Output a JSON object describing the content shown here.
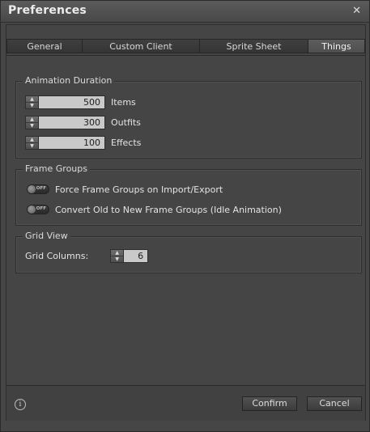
{
  "window": {
    "title": "Preferences",
    "close_icon": "close-icon"
  },
  "tabs": [
    {
      "label": "General"
    },
    {
      "label": "Custom Client"
    },
    {
      "label": "Sprite Sheet"
    },
    {
      "label": "Things",
      "active": true
    }
  ],
  "animation_duration": {
    "title": "Animation Duration",
    "rows": [
      {
        "value": "500",
        "label": "Items"
      },
      {
        "value": "300",
        "label": "Outfits"
      },
      {
        "value": "100",
        "label": "Effects"
      }
    ]
  },
  "frame_groups": {
    "title": "Frame Groups",
    "toggles": [
      {
        "state": "OFF",
        "label": "Force Frame Groups on Import/Export"
      },
      {
        "state": "OFF",
        "label": "Convert Old to New Frame Groups (Idle Animation)"
      }
    ]
  },
  "grid_view": {
    "title": "Grid View",
    "label": "Grid Columns:",
    "value": "6"
  },
  "footer": {
    "info_icon": "info-icon",
    "confirm_label": "Confirm",
    "cancel_label": "Cancel"
  },
  "colors": {
    "window_bg": "#464646",
    "input_bg": "#c9c9c9",
    "tab_active": "#5a5a5a"
  }
}
